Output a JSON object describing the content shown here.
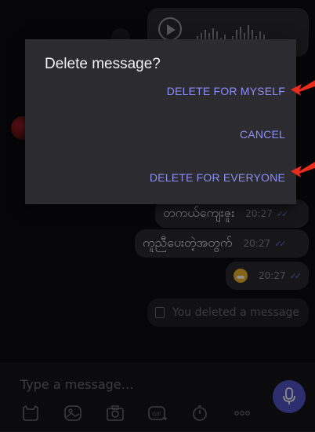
{
  "dialog": {
    "title": "Delete message?",
    "delete_for_myself": "DELETE FOR MYSELF",
    "cancel": "CANCEL",
    "delete_for_everyone": "DELETE FOR EVERYONE"
  },
  "messages": [
    {
      "text": "တကယ်ကျေးဇူး",
      "time": "20:27"
    },
    {
      "text": "ကူညီပေးတဲ့အတွက်",
      "time": "20:27"
    },
    {
      "time": "20:27",
      "icon": "grinning-emoji-icon"
    }
  ],
  "deleted_message": {
    "text": "You deleted a message"
  },
  "composer": {
    "placeholder": "Type a message…",
    "toolbar_icons": [
      "sticker-icon",
      "gallery-icon",
      "camera-icon",
      "gif-icon",
      "timer-icon",
      "more-icon"
    ],
    "gif_label": "GIF"
  },
  "colors": {
    "accent": "#5155c8",
    "dialog_button": "#8b8ef4",
    "annotation_arrow": "#e82c1e"
  }
}
